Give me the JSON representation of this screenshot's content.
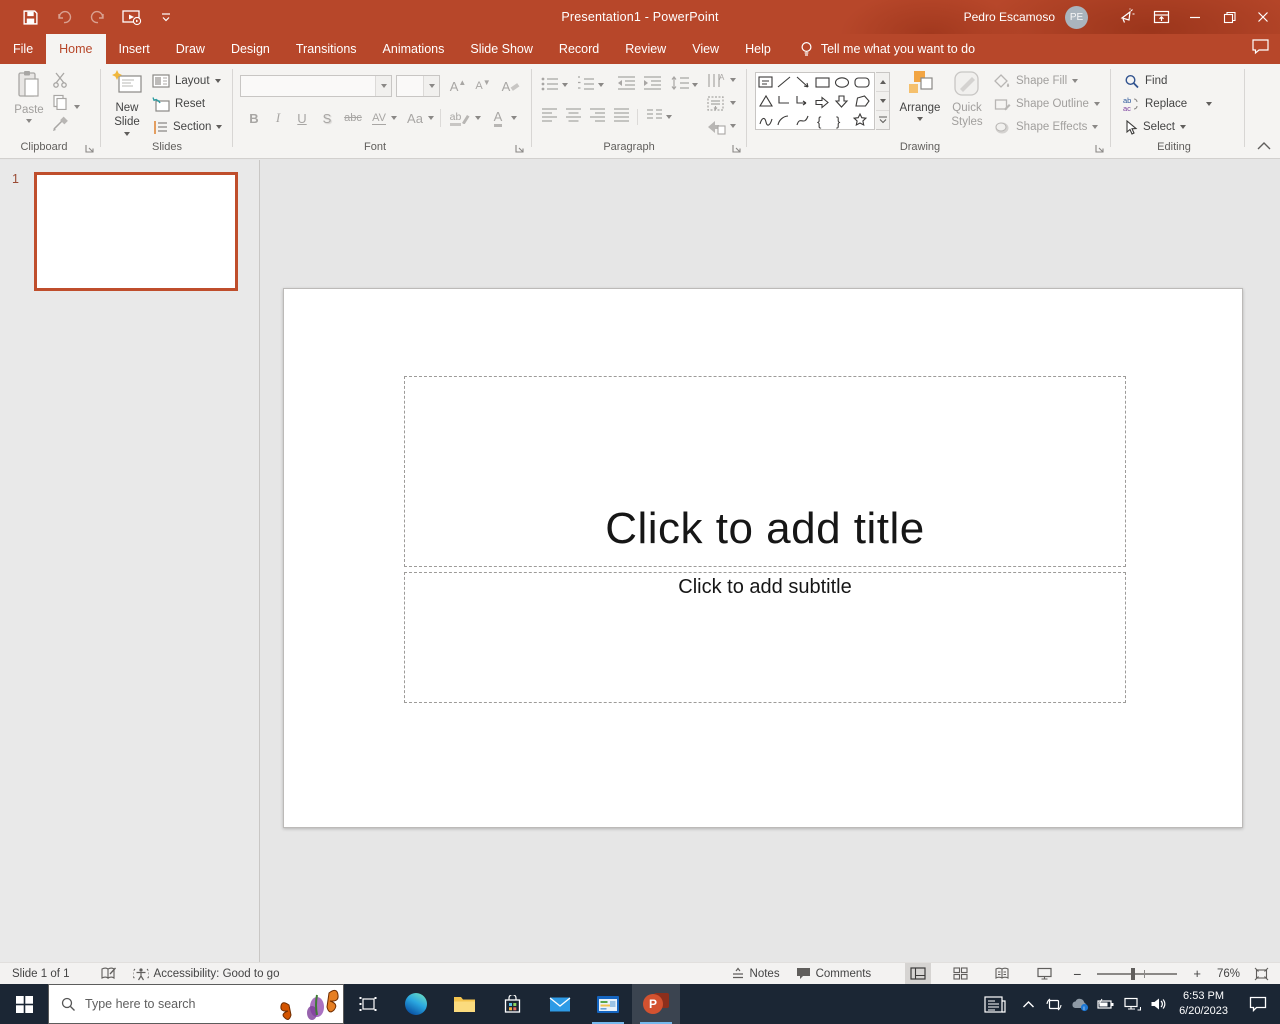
{
  "titlebar": {
    "title": "Presentation1 - PowerPoint"
  },
  "account": {
    "name": "Pedro Escamoso",
    "initials": "PE"
  },
  "tabs": {
    "items": [
      "File",
      "Home",
      "Insert",
      "Draw",
      "Design",
      "Transitions",
      "Animations",
      "Slide Show",
      "Record",
      "Review",
      "View",
      "Help"
    ],
    "active": "Home",
    "tell_me": "Tell me what you want to do"
  },
  "ribbon": {
    "clipboard": {
      "label": "Clipboard",
      "paste": "Paste"
    },
    "slides": {
      "label": "Slides",
      "new_slide": "New Slide",
      "layout": "Layout",
      "reset": "Reset",
      "section": "Section"
    },
    "font": {
      "label": "Font",
      "bold": "B",
      "italic": "I",
      "underline": "U",
      "shadow": "S",
      "strikethrough": "abc",
      "char_spacing": "AV",
      "change_case": "Aa",
      "highlight": "ab",
      "font_color": "A",
      "grow_font": "A",
      "shrink_font": "A",
      "clear_format": "A"
    },
    "paragraph": {
      "label": "Paragraph"
    },
    "drawing": {
      "label": "Drawing",
      "arrange": "Arrange",
      "quick_styles": "Quick Styles",
      "shape_fill": "Shape Fill",
      "shape_outline": "Shape Outline",
      "shape_effects": "Shape Effects"
    },
    "editing": {
      "label": "Editing",
      "find": "Find",
      "replace": "Replace",
      "select": "Select"
    }
  },
  "thumbnails": {
    "slide_number": "1"
  },
  "canvas": {
    "title_placeholder": "Click to add title",
    "subtitle_placeholder": "Click to add subtitle"
  },
  "statusbar": {
    "slide_indicator": "Slide 1 of 1",
    "accessibility": "Accessibility: Good to go",
    "notes": "Notes",
    "comments": "Comments",
    "zoom": "76%"
  },
  "taskbar": {
    "search_placeholder": "Type here to search",
    "clock_time": "6:53 PM",
    "clock_date": "6/20/2023",
    "powerpoint_letter": "P"
  },
  "colors": {
    "titlebar_red": "#b7472a",
    "ppt_accent": "#d35230",
    "taskbar_dark": "#1b2634",
    "selection_border": "#bf4e2c"
  }
}
